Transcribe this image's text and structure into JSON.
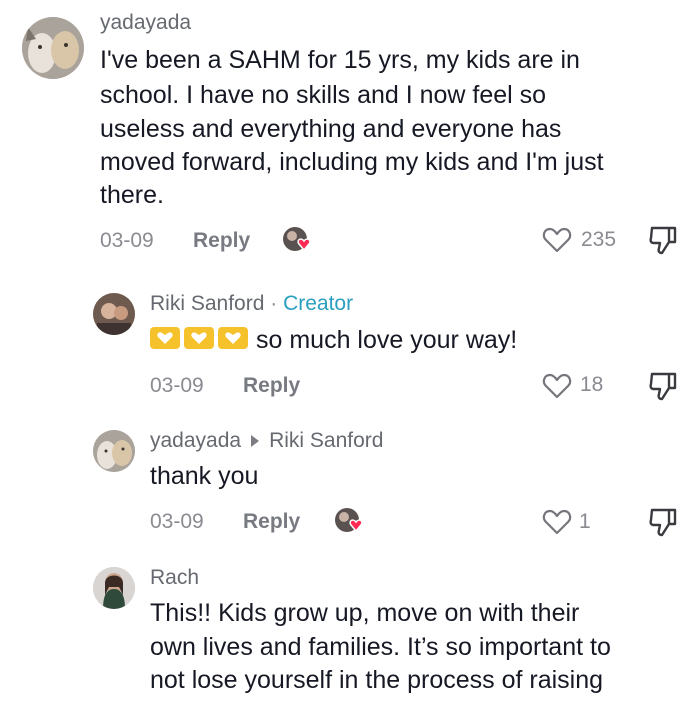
{
  "comments": [
    {
      "username": "yadayada",
      "lines": [
        "I've been a SAHM for 15 yrs, my kids are in",
        "school. I have no skills and I now feel so",
        "useless and everything and everyone has",
        "moved forward, including my kids and I'm just",
        "there."
      ],
      "date": "03-09",
      "reply": "Reply",
      "likes": "235"
    },
    {
      "username": "Riki Sanford",
      "separator": "·",
      "badge": "Creator",
      "text": "so much love your way!",
      "date": "03-09",
      "reply": "Reply",
      "likes": "18"
    },
    {
      "username": "yadayada",
      "reply_to": "Riki Sanford",
      "text": "thank you",
      "date": "03-09",
      "reply": "Reply",
      "likes": "1"
    },
    {
      "username": "Rach",
      "lines": [
        "This!! Kids grow up, move on with their",
        "own lives and families. It’s so important to",
        "not lose yourself in the process of raising"
      ]
    }
  ],
  "icons": {
    "like": "heart-outline-icon",
    "dislike": "thumbs-down-icon",
    "creator_liked": "creator-heart-badge-icon",
    "emoji": "yellow-heart-emoji-icon"
  },
  "colors": {
    "creator_accent": "#2a9fc0",
    "heart_badge": "#fe2c55",
    "emoji_heart": "#f6c22b"
  }
}
